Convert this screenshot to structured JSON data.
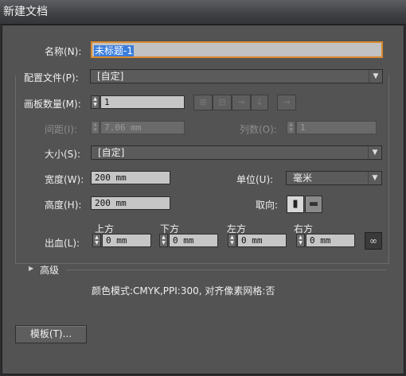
{
  "window": {
    "title": "新建文档"
  },
  "name": {
    "label": "名称(N):",
    "value": "未标题-1"
  },
  "profile": {
    "label": "配置文件(P):",
    "value": "[自定]"
  },
  "artboards": {
    "count_label": "画板数量(M):",
    "count_value": "1",
    "spacing_label": "间距(I):",
    "spacing_value": "7.06 mm",
    "columns_label": "列数(O):",
    "columns_value": "1",
    "arrange_icons": [
      "grid-by-row-icon",
      "grid-by-column-icon",
      "arrange-by-row-icon",
      "arrange-by-column-icon",
      "right-to-left-icon"
    ]
  },
  "size": {
    "label": "大小(S):",
    "value": "[自定]"
  },
  "width": {
    "label": "宽度(W):",
    "value": "200 mm"
  },
  "units": {
    "label": "单位(U):",
    "value": "毫米"
  },
  "height": {
    "label": "高度(H):",
    "value": "200 mm"
  },
  "orientation": {
    "label": "取向:",
    "icons": [
      "portrait-icon",
      "landscape-icon"
    ]
  },
  "bleed": {
    "label": "出血(L):",
    "top_label": "上方",
    "top_value": "0 mm",
    "bottom_label": "下方",
    "bottom_value": "0 mm",
    "left_label": "左方",
    "left_value": "0 mm",
    "right_label": "右方",
    "right_value": "0 mm",
    "link_icon": "chain-link-icon"
  },
  "advanced": {
    "label": "高级"
  },
  "summary": {
    "text": "颜色模式:CMYK,PPI:300, 对齐像素网格:否"
  },
  "buttons": {
    "templates_label": "模板(T)..."
  },
  "colors": {
    "focus_border": "#d98a2e",
    "selection": "#3a7ddb",
    "dialog_bg": "#535353"
  }
}
